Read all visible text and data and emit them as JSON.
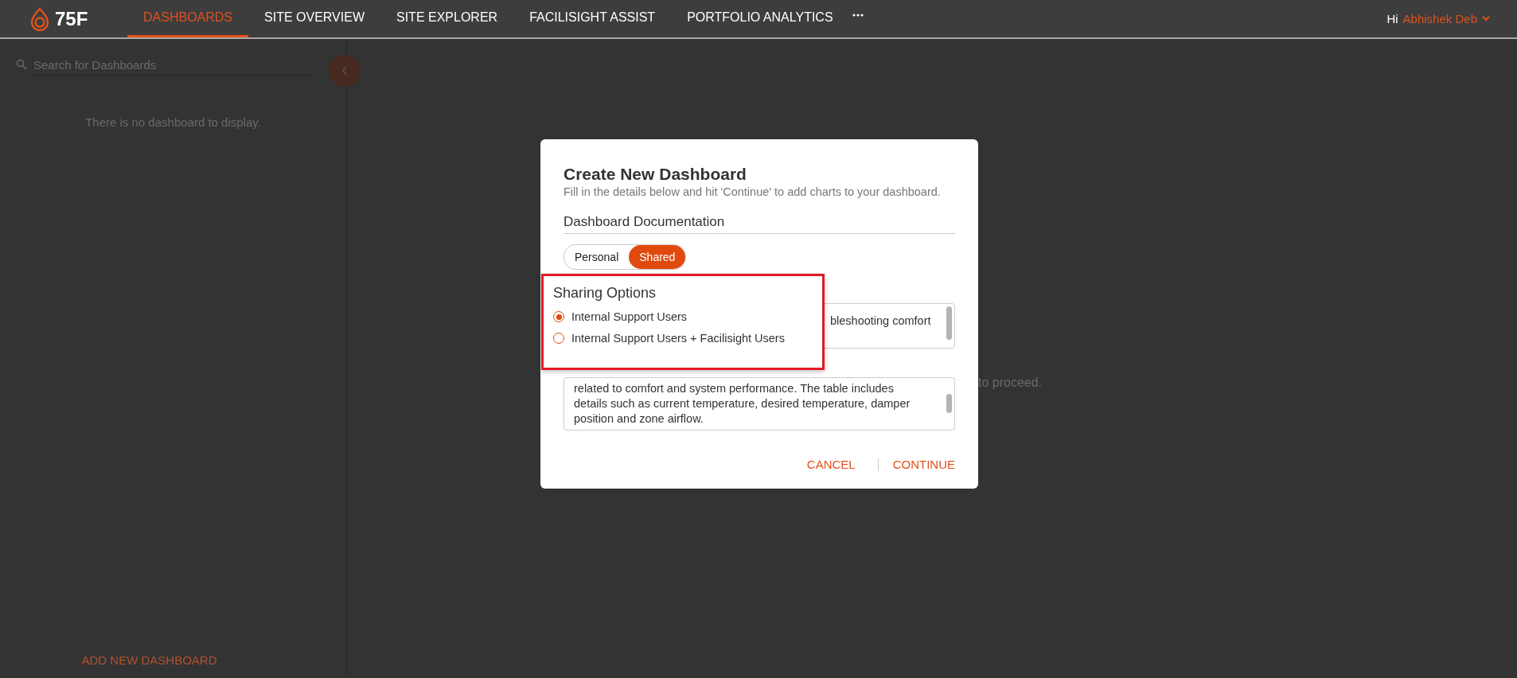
{
  "header": {
    "logo": "75F",
    "nav": [
      {
        "label": "DASHBOARDS",
        "selected": true
      },
      {
        "label": "SITE OVERVIEW",
        "selected": false
      },
      {
        "label": "SITE EXPLORER",
        "selected": false
      },
      {
        "label": "FACILISIGHT ASSIST",
        "selected": false
      },
      {
        "label": "PORTFOLIO ANALYTICS",
        "selected": false
      }
    ],
    "greeting": "Hi",
    "user": "Abhishek Deb"
  },
  "sidebar": {
    "search": {
      "placeholder": "Search for Dashboards"
    },
    "empty_message": "There is no dashboard to display.",
    "add_button": "ADD NEW DASHBOARD"
  },
  "main": {
    "message": "to proceed."
  },
  "dialog": {
    "title": "Create New Dashboard",
    "subtitle": "Fill in the details below and hit 'Continue' to add charts to your dashboard.",
    "section": "Dashboard Documentation",
    "visibility": [
      {
        "label": "Personal",
        "selected": false
      },
      {
        "label": "Shared",
        "selected": true
      }
    ],
    "sharing": {
      "title": "Sharing Options",
      "options": [
        {
          "label": "Internal Support Users",
          "selected": true
        },
        {
          "label": "Internal Support Users + Facilisight Users",
          "selected": false
        }
      ]
    },
    "fields": [
      {
        "value": "bleshooting comfort"
      },
      {
        "value": "related to comfort and system performance. The table includes details such as current temperature, desired temperature, damper position and zone airflow."
      }
    ],
    "buttons": [
      {
        "label": "CANCEL"
      },
      {
        "label": "CONTINUE"
      }
    ]
  }
}
